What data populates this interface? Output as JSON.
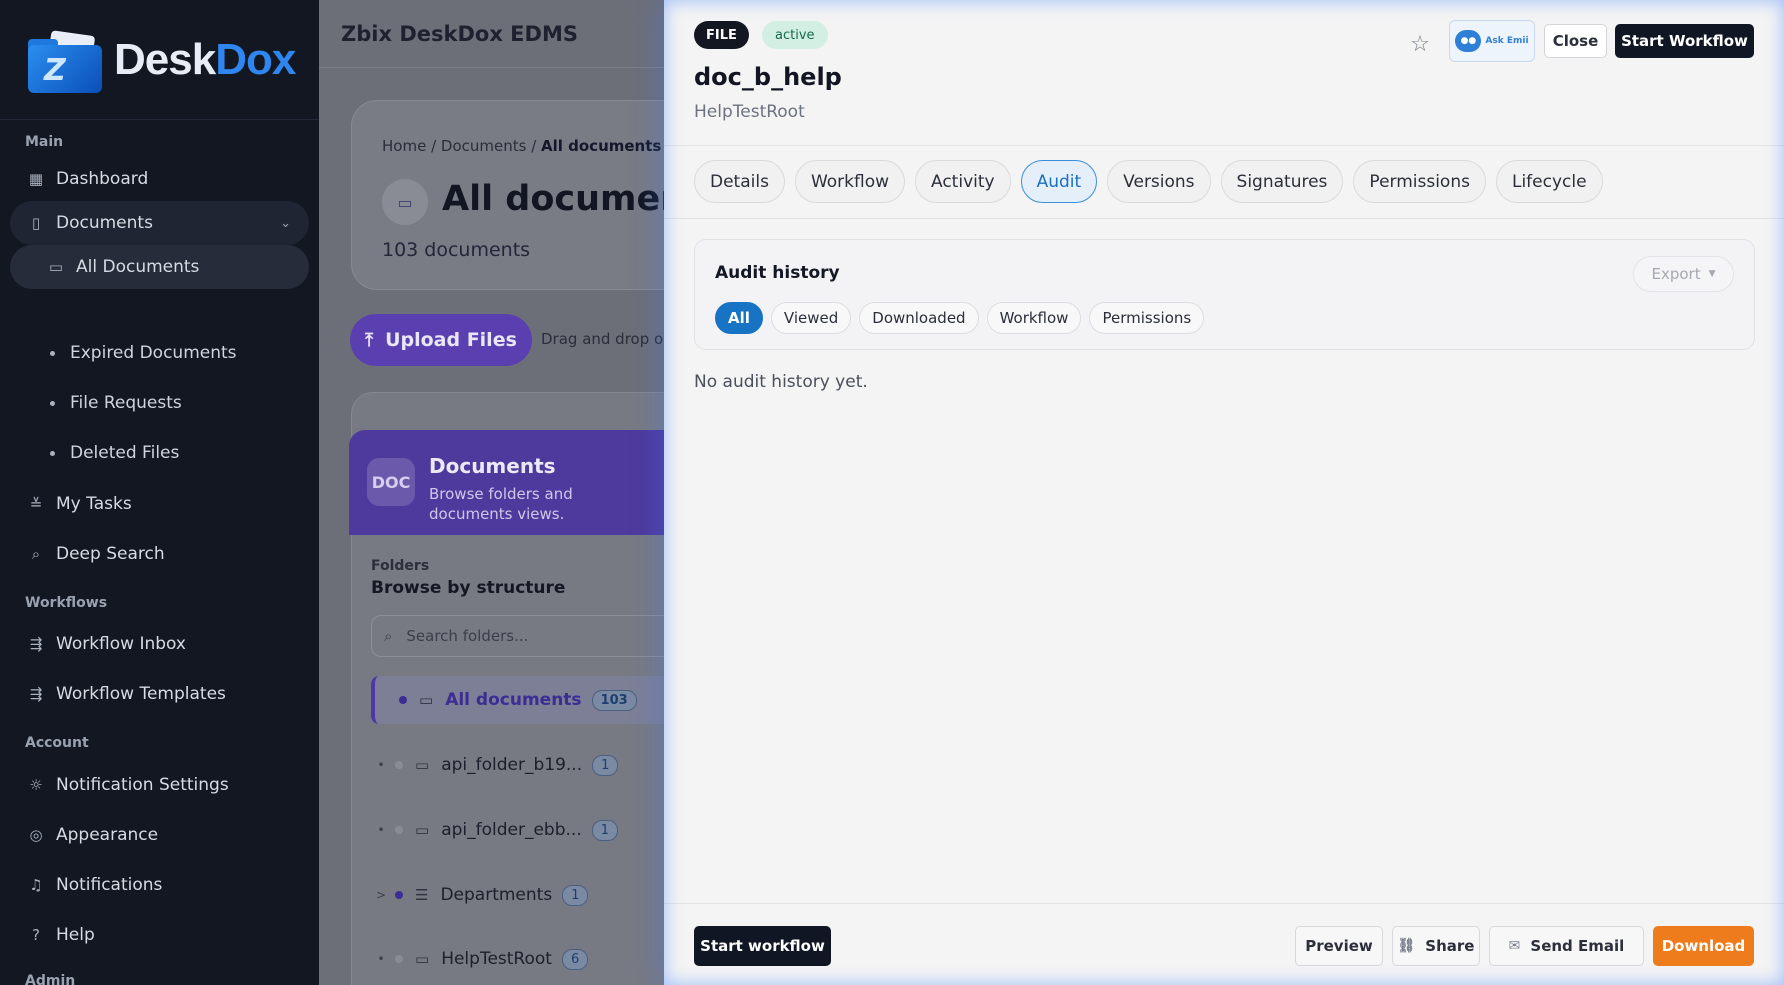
{
  "sidebar": {
    "brand": {
      "desk": "Desk",
      "dox": "Dox"
    },
    "sections": {
      "main": "Main",
      "workflows": "Workflows",
      "account": "Account",
      "admin": "Admin"
    },
    "items": {
      "dashboard": "Dashboard",
      "documents": "Documents",
      "all_documents": "All Documents",
      "expired_documents": "Expired Documents",
      "file_requests": "File Requests",
      "deleted_files": "Deleted Files",
      "my_tasks": "My Tasks",
      "deep_search": "Deep Search",
      "workflow_inbox": "Workflow Inbox",
      "workflow_templates": "Workflow Templates",
      "notification_settings": "Notification Settings",
      "appearance": "Appearance",
      "notifications": "Notifications",
      "help": "Help"
    }
  },
  "main": {
    "app_title": "Zbix DeskDox EDMS",
    "breadcrumb": {
      "home": "Home",
      "documents": "Documents",
      "current": "All documents"
    },
    "page_title": "All documents",
    "doc_count": "103 documents",
    "upload_label": "Upload Files",
    "drag_hint": "Drag and drop or",
    "panel": {
      "badge": "DOC",
      "title": "Documents",
      "subtitle": "Browse folders and documents views."
    },
    "folders": {
      "label": "Folders",
      "title": "Browse by structure",
      "search_placeholder": "Search folders...",
      "rows": [
        {
          "name": "All documents",
          "count": "103",
          "lead": ""
        },
        {
          "name": "api_folder_b19...",
          "count": "1",
          "lead": "•"
        },
        {
          "name": "api_folder_ebb...",
          "count": "1",
          "lead": "•"
        },
        {
          "name": "Departments",
          "count": "1",
          "lead": ">"
        },
        {
          "name": "HelpTestRoot",
          "count": "6",
          "lead": "•"
        }
      ]
    }
  },
  "drawer": {
    "type_badge": "FILE",
    "status_badge": "active",
    "title": "doc_b_help",
    "folder": "HelpTestRoot",
    "askemi_label": "Ask Emii",
    "close_label": "Close",
    "start_workflow_label": "Start Workflow",
    "tabs": [
      "Details",
      "Workflow",
      "Activity",
      "Audit",
      "Versions",
      "Signatures",
      "Permissions",
      "Lifecycle"
    ],
    "active_tab": "Audit",
    "audit": {
      "title": "Audit history",
      "export_label": "Export",
      "filters": [
        "All",
        "Viewed",
        "Downloaded",
        "Workflow",
        "Permissions"
      ],
      "active_filter": "All",
      "empty": "No audit history yet."
    },
    "footer": {
      "start_workflow": "Start workflow",
      "preview": "Preview",
      "share": "Share",
      "send_email": "Send Email",
      "download": "Download"
    }
  },
  "colors": {
    "accent_blue": "#1773c4",
    "download_orange": "#ef7c1c",
    "dark": "#111624",
    "upload_purple": "#5a3fb0",
    "active_green_bg": "#d3efe4"
  }
}
